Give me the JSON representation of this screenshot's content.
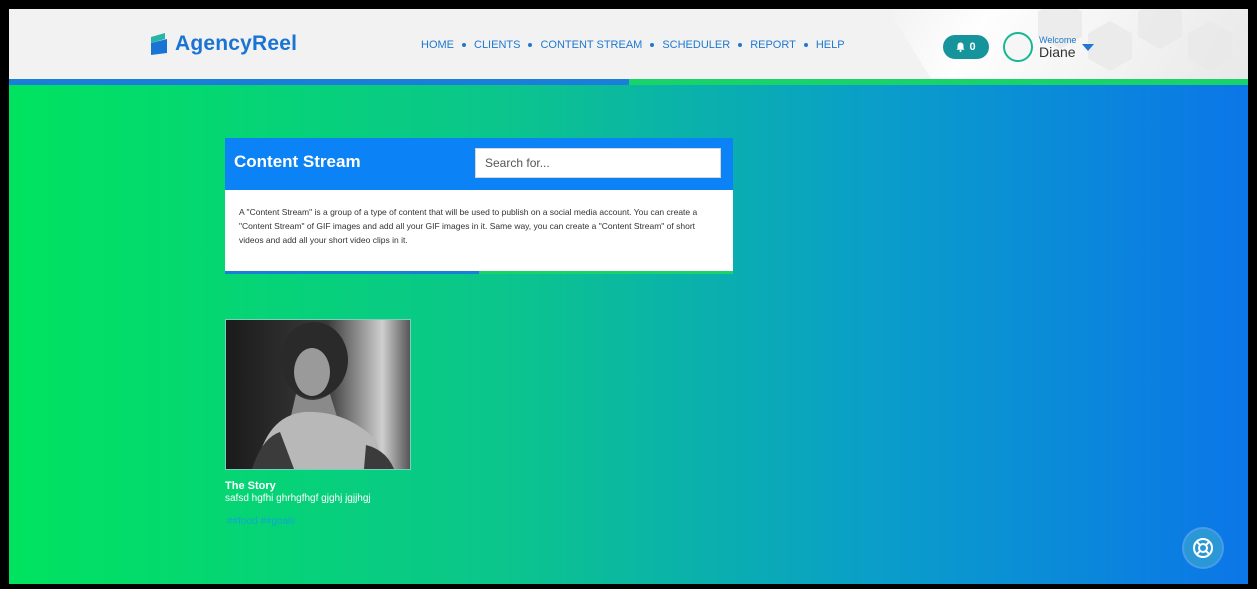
{
  "header": {
    "brand": "AgencyReel",
    "nav": [
      {
        "label": "HOME"
      },
      {
        "label": "CLIENTS"
      },
      {
        "label": "CONTENT STREAM"
      },
      {
        "label": "SCHEDULER"
      },
      {
        "label": "REPORT"
      },
      {
        "label": "HELP"
      }
    ],
    "notifications": {
      "count": "0",
      "icon": "bell-icon"
    },
    "user": {
      "welcome": "Welcome",
      "name": "Diane",
      "caret_icon": "caret-down-icon"
    }
  },
  "content_stream": {
    "title": "Content Stream",
    "search_placeholder": "Search for...",
    "description": "A \"Content Stream\" is a group of a type of content that will be used to publish on a social media account. You can create a \"Content Stream\" of GIF images and add all your GIF images in it. Same way, you can create a \"Content Stream\" of short videos and add all your short video clips in it."
  },
  "stream_item": {
    "title": "The Story",
    "description": "safsd hgfhi ghrhgfhgf gjghj jgjjhgj",
    "tags": "##food ##goals"
  },
  "help_button": {
    "icon": "lifebuoy-icon"
  },
  "colors": {
    "brand_blue": "#1a74d4",
    "gradient_start": "#00e35f",
    "gradient_end": "#0b76e8",
    "card_header": "#0b82f5",
    "notif_badge": "#16949b"
  }
}
